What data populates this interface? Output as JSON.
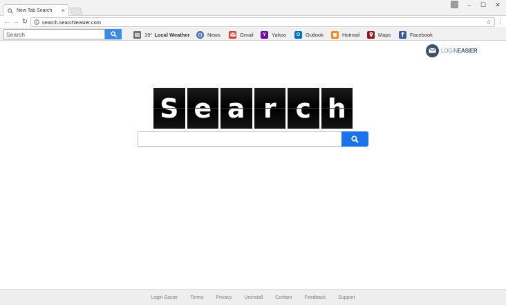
{
  "browser": {
    "tab_title": "New Tab Search",
    "tab_close": "×",
    "url": "search.searchleasier.com",
    "window_controls": {
      "minimize": "–",
      "maximize": "☐",
      "close": "✕"
    },
    "star": "☆",
    "menu": "⋮"
  },
  "toolbar": {
    "search_placeholder": "Search",
    "links": [
      {
        "temp": "19°",
        "label": "Local Weather",
        "icon": "weather-icon"
      },
      {
        "label": "News",
        "icon": "news-icon",
        "color": "#4a6ea9"
      },
      {
        "label": "Gmail",
        "icon": "gmail-icon",
        "color": "#d44638"
      },
      {
        "label": "Yahoo",
        "icon": "yahoo-icon",
        "color": "#720e9e"
      },
      {
        "label": "Outlook",
        "icon": "outlook-icon",
        "color": "#0072c6"
      },
      {
        "label": "Hotmail",
        "icon": "hotmail-icon",
        "color": "#f08a1c"
      },
      {
        "label": "Maps",
        "icon": "maps-icon",
        "color": "#8b1a1a"
      },
      {
        "label": "Facebook",
        "icon": "facebook-icon",
        "color": "#3b5998"
      }
    ]
  },
  "brand": {
    "part1": "LOGIN",
    "part2": "EASIER"
  },
  "logo": {
    "letters": [
      "S",
      "e",
      "a",
      "r",
      "c",
      "h"
    ]
  },
  "main": {
    "search_value": "",
    "button_color": "#1a73e8"
  },
  "footer": {
    "links": [
      "Login Easier",
      "Terms",
      "Privacy",
      "Uninstall",
      "Contact",
      "Feedback",
      "Support"
    ]
  }
}
